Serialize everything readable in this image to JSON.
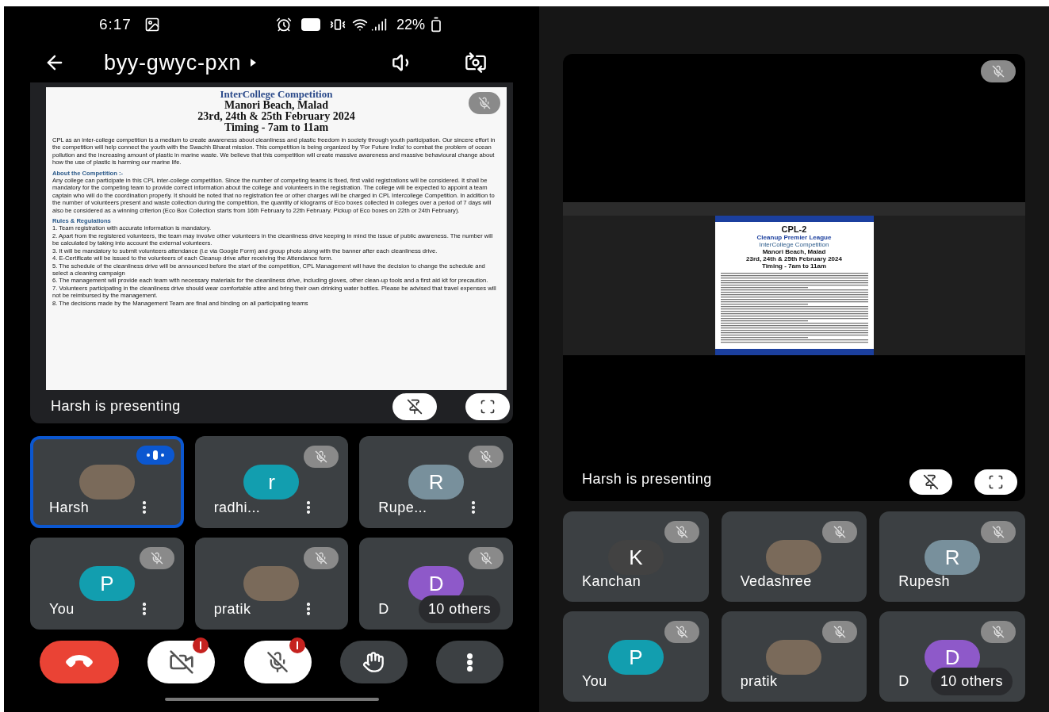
{
  "left_phone": {
    "status_bar": {
      "time": "6:17",
      "battery": "22%"
    },
    "header": {
      "title": "byy-gwyc-pxn"
    },
    "presentation": {
      "presenter_muted": true,
      "caption": "Harsh is presenting",
      "document": {
        "heading": "InterCollege Competition",
        "place": "Manori Beach, Malad",
        "dates": "23rd, 24th & 25th February 2024",
        "timing": "Timing - 7am to 11am",
        "intro": "CPL as an inter-college competition is a medium to create awareness about cleanliness and plastic freedom in society through youth participation. Our sincere effort in the competition will help connect the youth with the Swachh Bharat mission. This competition is being organized by 'For Future India' to combat the problem of ocean pollution and the increasing amount of plastic in marine waste. We believe that this competition will create massive awareness and massive behavioural change about how the use of plastic is harming our marine life.",
        "sections": [
          {
            "title": "About the Competition :-",
            "paragraphs": [
              "Any college can participate in this CPL inter-college competition. Since the number of competing teams is fixed, first valid registrations will be considered. It shall be mandatory for the competing team to provide correct information about the college and volunteers in the registration. The college will be expected to appoint a team captain who will do the coordination properly. It should be noted that no registration fee or other charges will be charged in CPL Intercollege Competition. In addition to the number of volunteers present and waste collection during the competition, the quantity of kilograms of Eco boxes collected in colleges over a period of 7 days will also be considered as a winning criterion (Eco Box Collection starts from 16th February to 22th February. Pickup of Eco boxes on 22th or 24th February)."
            ]
          },
          {
            "title": "Rules & Regulations",
            "paragraphs": [
              "1. Team registration with accurate information is mandatory.",
              "2. Apart from the registered volunteers, the team may involve other volunteers in the cleanliness drive keeping in mind the issue of public awareness. The number will be calculated by taking into account the external volunteers.",
              "3. It will be mandatory to submit volunteers attendance (i.e via Google Form) and group photo along with the banner after each cleanliness drive.",
              "4. E-Certificate will be issued to the volunteers of each Cleanup drive after receiving the Attendance form.",
              "5. The schedule of the cleanliness drive will be announced before the start of the competition, CPL Management will have the decision to change the schedule and select a cleaning campaign",
              "6. The management will provide each team with necessary materials for the cleanliness drive, including gloves, other clean-up tools and a first aid kit for precaution.",
              "7. Volunteers participating in the cleanliness drive should wear comfortable attire and bring their own drinking water bottles. Please be advised that travel expenses will not be reimbursed by the management.",
              "8. The decisions made by the Management Team are final and binding on all participating teams"
            ]
          }
        ]
      }
    },
    "tiles": [
      {
        "name": "Harsh",
        "kind": "photo",
        "speaking": true,
        "muted": false,
        "menu": true
      },
      {
        "name": "radhi...",
        "kind": "initial",
        "initial": "r",
        "color": "#129eaf",
        "speaking": false,
        "muted": true,
        "menu": true
      },
      {
        "name": "Rupe...",
        "kind": "initial",
        "initial": "R",
        "color": "#78909c",
        "speaking": false,
        "muted": true,
        "menu": true
      },
      {
        "name": "You",
        "kind": "initial",
        "initial": "P",
        "color": "#129eaf",
        "speaking": false,
        "muted": true,
        "menu": true
      },
      {
        "name": "pratik",
        "kind": "photo",
        "speaking": false,
        "muted": true,
        "menu": true
      },
      {
        "name": "D",
        "kind": "initial",
        "initial": "D",
        "color": "#8e59c9",
        "speaking": false,
        "muted": true,
        "menu": false,
        "others": "10 others"
      }
    ],
    "controls": [
      {
        "kind": "end-call",
        "alert": false
      },
      {
        "kind": "camera",
        "alert": true
      },
      {
        "kind": "mic",
        "alert": true
      },
      {
        "kind": "hand",
        "alert": false
      },
      {
        "kind": "more",
        "alert": false
      }
    ]
  },
  "right_phone": {
    "presentation": {
      "presenter_muted": true,
      "caption": "Harsh is presenting",
      "shared_screen": {
        "title": "CPL-2",
        "subtitle": "Cleanup Premier League",
        "heading": "InterCollege Competition",
        "place": "Manori Beach, Malad",
        "dates": "23rd, 24th & 25th February 2024",
        "timing": "Timing - 7am to 11am"
      }
    },
    "tiles": [
      {
        "name": "Kanchan",
        "kind": "initial",
        "initial": "K",
        "color": "#424242",
        "speaking": false,
        "muted": true,
        "menu": false
      },
      {
        "name": "Vedashree",
        "kind": "photo",
        "speaking": false,
        "muted": true,
        "menu": false
      },
      {
        "name": "Rupesh",
        "kind": "initial",
        "initial": "R",
        "color": "#78909c",
        "speaking": false,
        "muted": true,
        "menu": false
      },
      {
        "name": "You",
        "kind": "initial",
        "initial": "P",
        "color": "#129eaf",
        "speaking": false,
        "muted": true,
        "menu": false
      },
      {
        "name": "pratik",
        "kind": "photo",
        "speaking": false,
        "muted": true,
        "menu": false
      },
      {
        "name": "D",
        "kind": "initial",
        "initial": "D",
        "color": "#8e59c9",
        "speaking": false,
        "muted": true,
        "menu": false,
        "others": "10 others"
      }
    ]
  }
}
